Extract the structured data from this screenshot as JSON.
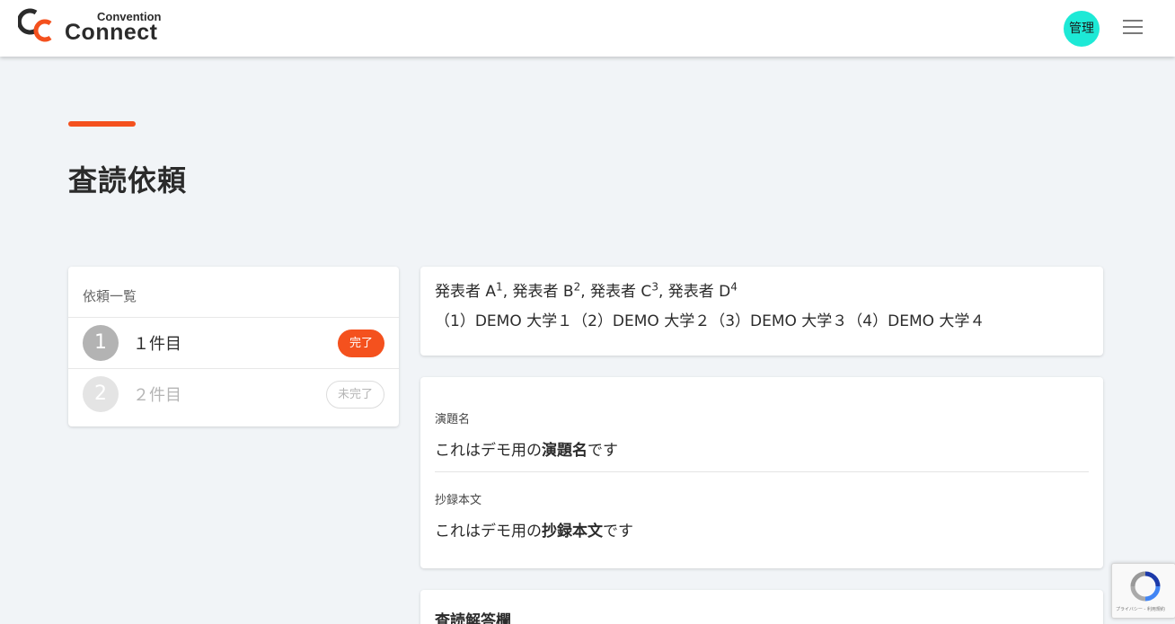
{
  "header": {
    "logo_small": "Convention",
    "logo_large": "Connect",
    "admin_label": "管理",
    "menu_icon": "hamburger-icon",
    "colors": {
      "accent": "#f4511e",
      "admin_badge": "#1de9d6"
    }
  },
  "page": {
    "title": "査読依頼"
  },
  "request_list": {
    "heading": "依頼一覧",
    "items": [
      {
        "number": "1",
        "label": "１件目",
        "status": "完了"
      },
      {
        "number": "2",
        "label": "２件目",
        "status": "未完了"
      }
    ]
  },
  "authors": {
    "names": [
      {
        "name": "発表者 A",
        "sup": "1",
        "sep": ", "
      },
      {
        "name": "発表者 B",
        "sup": "2",
        "sep": ", "
      },
      {
        "name": "発表者 C",
        "sup": "3",
        "sep": ", "
      },
      {
        "name": "発表者 D",
        "sup": "4",
        "sep": ""
      }
    ],
    "affiliations": "（1）DEMO 大学１（2）DEMO 大学２（3）DEMO 大学３（4）DEMO 大学４"
  },
  "abstract": {
    "title_label": "演題名",
    "title_prefix": "これはデモ用の",
    "title_bold": "演題名",
    "title_suffix": "です",
    "body_label": "抄録本文",
    "body_prefix": "これはデモ用の",
    "body_bold": "抄録本文",
    "body_suffix": "です"
  },
  "answer": {
    "heading": "査読解答欄"
  },
  "recaptcha": {
    "text": "プライバシー - 利用規約"
  }
}
